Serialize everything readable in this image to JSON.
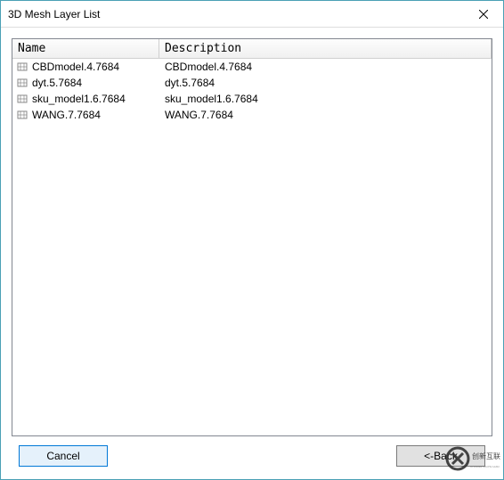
{
  "window": {
    "title": "3D Mesh Layer List"
  },
  "list": {
    "headers": {
      "name": "Name",
      "description": "Description"
    },
    "rows": [
      {
        "name": "CBDmodel.4.7684",
        "description": "CBDmodel.4.7684"
      },
      {
        "name": "dyt.5.7684",
        "description": "dyt.5.7684"
      },
      {
        "name": "sku_model1.6.7684",
        "description": "sku_model1.6.7684"
      },
      {
        "name": "WANG.7.7684",
        "description": "WANG.7.7684"
      }
    ]
  },
  "buttons": {
    "cancel": "Cancel",
    "back": "<-Back"
  },
  "watermark": {
    "text_top": "创新互联",
    "text_bottom": "CHUANG XIN HU LIAN"
  }
}
